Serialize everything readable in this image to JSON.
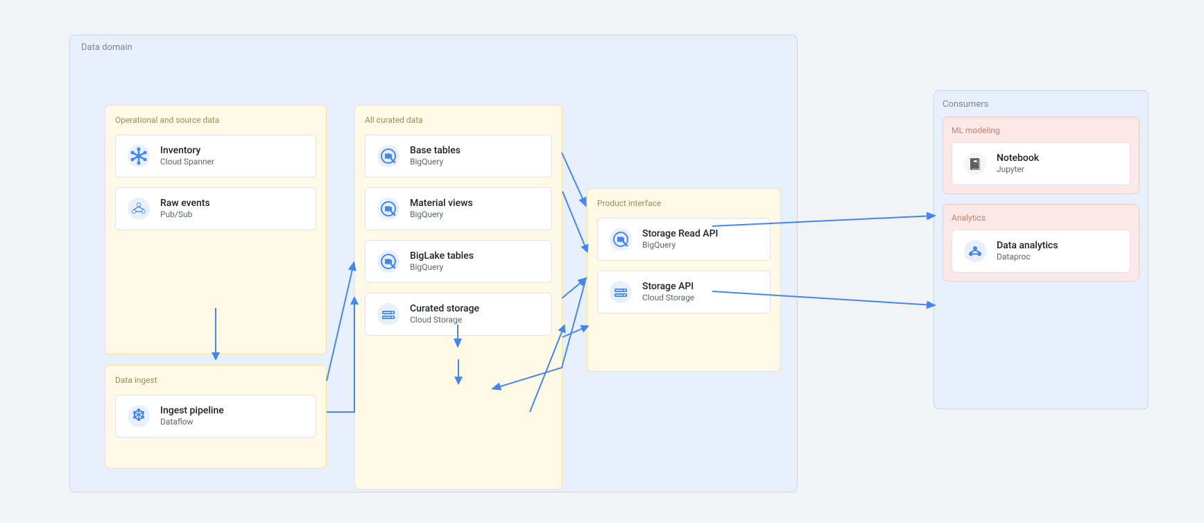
{
  "dataDomain": {
    "label": "Data domain",
    "operationalSource": {
      "label": "Operational and source data",
      "cards": [
        {
          "id": "inventory",
          "name": "Inventory",
          "sub": "Cloud Spanner",
          "icon": "spanner"
        },
        {
          "id": "rawevents",
          "name": "Raw events",
          "sub": "Pub/Sub",
          "icon": "pubsub"
        }
      ]
    },
    "dataIngest": {
      "label": "Data ingest",
      "cards": [
        {
          "id": "ingest",
          "name": "Ingest pipeline",
          "sub": "Dataflow",
          "icon": "dataflow"
        }
      ]
    },
    "allCurated": {
      "label": "All curated data",
      "cards": [
        {
          "id": "basetables",
          "name": "Base tables",
          "sub": "BigQuery",
          "icon": "bq"
        },
        {
          "id": "materialviews",
          "name": "Material  views",
          "sub": "BigQuery",
          "icon": "bq"
        },
        {
          "id": "biglake",
          "name": "BigLake tables",
          "sub": "BigQuery",
          "icon": "bq"
        },
        {
          "id": "curatedstorage",
          "name": "Curated storage",
          "sub": "Cloud Storage",
          "icon": "storage"
        }
      ]
    },
    "productInterface": {
      "label": "Product interface",
      "cards": [
        {
          "id": "storagereadapi",
          "name": "Storage Read API",
          "sub": "BigQuery",
          "icon": "bq"
        },
        {
          "id": "storageapi",
          "name": "Storage API",
          "sub": "Cloud Storage",
          "icon": "storage"
        }
      ]
    }
  },
  "consumers": {
    "label": "Consumers",
    "mlModeling": {
      "label": "ML modeling",
      "cards": [
        {
          "id": "notebook",
          "name": "Notebook",
          "sub": "Jupyter",
          "icon": "jupyter"
        }
      ]
    },
    "analytics": {
      "label": "Analytics",
      "cards": [
        {
          "id": "dataanalytics",
          "name": "Data analytics",
          "sub": "Dataproc",
          "icon": "dataproc"
        }
      ]
    }
  }
}
